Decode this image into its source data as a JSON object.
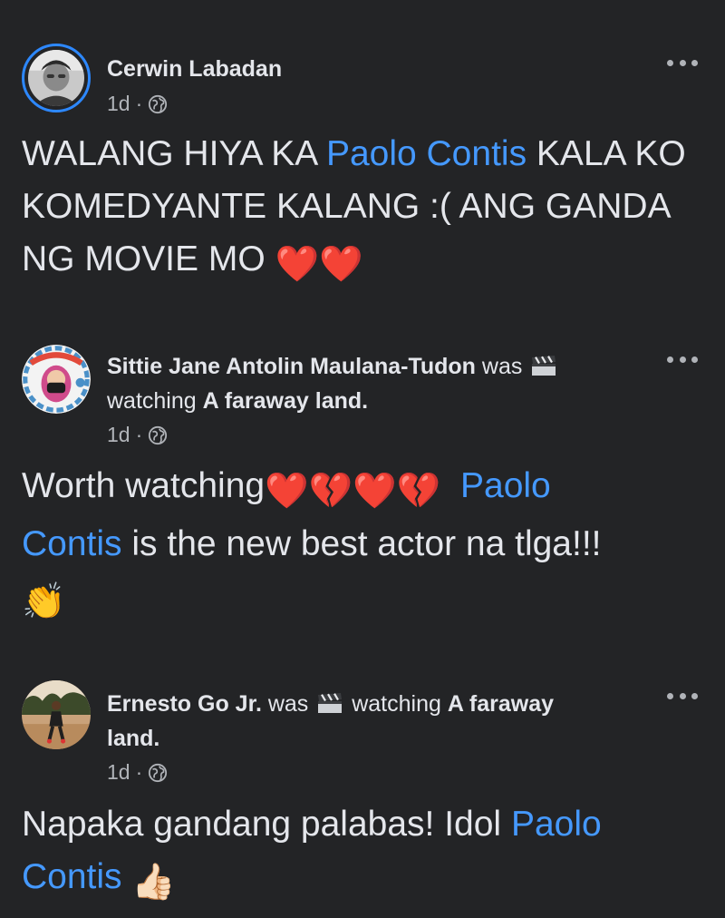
{
  "comments": [
    {
      "author": "Cerwin Labadan",
      "time": "1d",
      "separator": "·",
      "text_before": "WALANG HIYA KA ",
      "mention": "Paolo Contis",
      "text_after": " KALA KO KOMEDYANTE KALANG :( ANG GANDA NG MOVIE MO ",
      "emojis": "❤️❤️"
    },
    {
      "author": "Sittie Jane Antolin Maulana-Tudon",
      "was_label": "was",
      "activity_icon": "clapper-board-icon",
      "watching_label": "watching",
      "movie": "A faraway land.",
      "time": "1d",
      "separator": "·",
      "text_before": "Worth watching",
      "emojis": "❤️💔❤️💔",
      "mention_part1": "Paolo",
      "mention_part2": "Contis",
      "text_after": " is the new best actor na tlga!!!",
      "trailing_emoji": "👏"
    },
    {
      "author": "Ernesto Go Jr.",
      "was_label": "was",
      "activity_icon": "clapper-board-icon",
      "watching_label": "watching",
      "movie_part1": "A faraway",
      "movie_part2": "land.",
      "time": "1d",
      "separator": "·",
      "text_before": "Napaka gandang palabas! Idol ",
      "mention_part1": "Paolo",
      "mention_part2": "Contis",
      "trailing_emoji": "👍🏻"
    }
  ],
  "icons": {
    "more": "more-options-icon",
    "privacy": "globe-icon"
  },
  "colors": {
    "background": "#232426",
    "text": "#e4e6eb",
    "secondary_text": "#b0b3b8",
    "mention": "#4599ff",
    "story_ring": "#2d88ff"
  }
}
